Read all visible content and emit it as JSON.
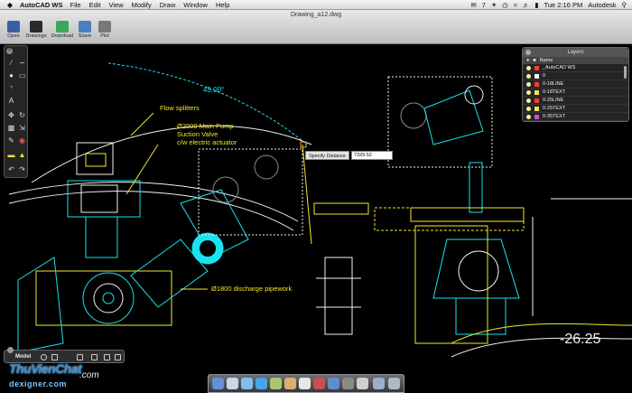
{
  "menubar": {
    "app_name": "AutoCAD WS",
    "items": [
      "File",
      "Edit",
      "View",
      "Modify",
      "Draw",
      "Window",
      "Help"
    ],
    "status_number": "7",
    "clock": "Tue 2:16 PM",
    "right_label": "Autodesk"
  },
  "window": {
    "title": "Drawing_a12.dwg",
    "toolbar": [
      {
        "label": "Open",
        "icon": "open-icon",
        "color": "#3a5fa5"
      },
      {
        "label": "Drawings",
        "icon": "drawings-icon",
        "color": "#2a2a2a"
      },
      {
        "label": "Download",
        "icon": "download-icon",
        "color": "#3aa85a"
      },
      {
        "label": "Share",
        "icon": "share-icon",
        "color": "#4a7fc0"
      },
      {
        "label": "Plot",
        "icon": "printer-icon",
        "color": "#777777"
      }
    ]
  },
  "palette": {
    "tools": [
      "line-icon",
      "polyline-icon",
      "circle-icon",
      "rectangle-icon",
      "arc-icon",
      "text-icon",
      "move-icon",
      "rotate-icon",
      "copy-icon",
      "scale-icon",
      "pencil-icon",
      "color-wheel-icon",
      "measure-icon",
      "markup-icon",
      "undo-icon",
      "redo-icon"
    ]
  },
  "layers_panel": {
    "title": "Layers",
    "column_name": "Name",
    "layers": [
      {
        "name": "_AutoCAD WS",
        "color": "#ff3b3b"
      },
      {
        "name": "0",
        "color": "#ffffff"
      },
      {
        "name": "0-18LINE",
        "color": "#ff3b3b"
      },
      {
        "name": "0-18TEXT",
        "color": "#e8e84a"
      },
      {
        "name": "0-25LINE",
        "color": "#ff3b3b"
      },
      {
        "name": "0-25TEXT",
        "color": "#e8e84a"
      },
      {
        "name": "0-35TEXT",
        "color": "#d846d8"
      }
    ]
  },
  "drawing": {
    "labels": {
      "angle": "45.00°",
      "flow_splitters": "Flow splitters",
      "pump_line1": "Ø2000 Main Pump",
      "pump_line2": "Suction Valve",
      "pump_line3": "c/w electric actuator",
      "discharge": "Ø1800 discharge pipework",
      "elevation": "-26.25"
    },
    "colors": {
      "cyan": "#19e3f0",
      "yellow": "#f2e82a",
      "white": "#f2f2f2",
      "grey": "#8a8a8a"
    }
  },
  "distance_input": {
    "label": "Specify Distance",
    "value": "7329.52"
  },
  "modelbar": {
    "tab": "Model"
  },
  "watermark": {
    "brand": "ThuVienChat",
    "suffix": ".com",
    "sub": "dexigner.com"
  }
}
